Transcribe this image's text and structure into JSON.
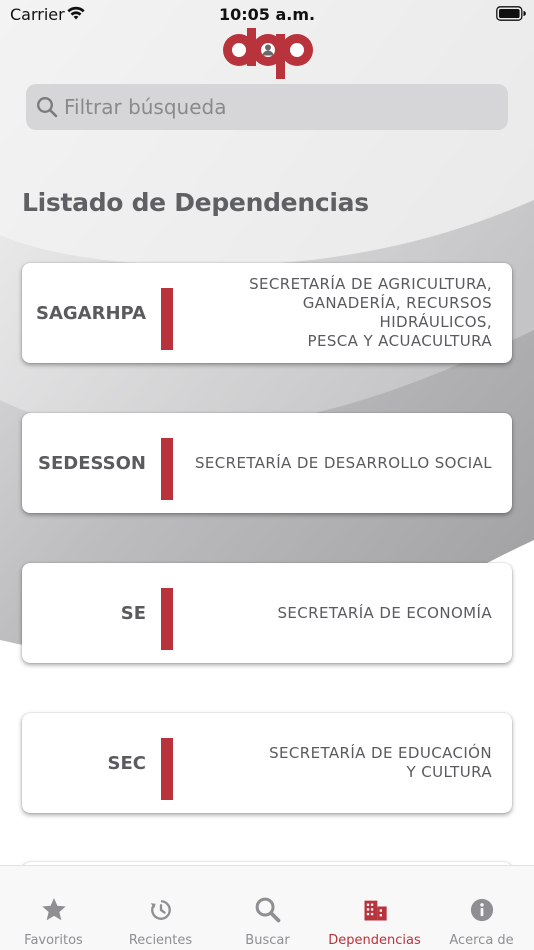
{
  "status_bar": {
    "carrier": "Carrier",
    "time": "10:05 a.m."
  },
  "search": {
    "placeholder": "Filtrar búsqueda",
    "value": ""
  },
  "title": "Listado de Dependencias",
  "accent_color": "#b8333b",
  "dependencies": [
    {
      "abbr": "SAGARHPA",
      "name": "SECRETARÍA DE AGRICULTURA,\nGANADERÍA, RECURSOS HIDRÁULICOS,\nPESCA Y ACUACULTURA"
    },
    {
      "abbr": "SEDESSON",
      "name": "SECRETARÍA DE DESARROLLO SOCIAL"
    },
    {
      "abbr": "SE",
      "name": "SECRETARÍA DE ECONOMÍA"
    },
    {
      "abbr": "SEC",
      "name": "SECRETARÍA DE EDUCACIÓN\nY CULTURA"
    },
    {
      "abbr": "",
      "name": ""
    }
  ],
  "tabs": [
    {
      "label": "Favoritos",
      "icon": "star-icon",
      "active": false
    },
    {
      "label": "Recientes",
      "icon": "clock-icon",
      "active": false
    },
    {
      "label": "Buscar",
      "icon": "search-icon",
      "active": false
    },
    {
      "label": "Dependencias",
      "icon": "building-icon",
      "active": true
    },
    {
      "label": "Acerca de",
      "icon": "info-icon",
      "active": false
    }
  ]
}
